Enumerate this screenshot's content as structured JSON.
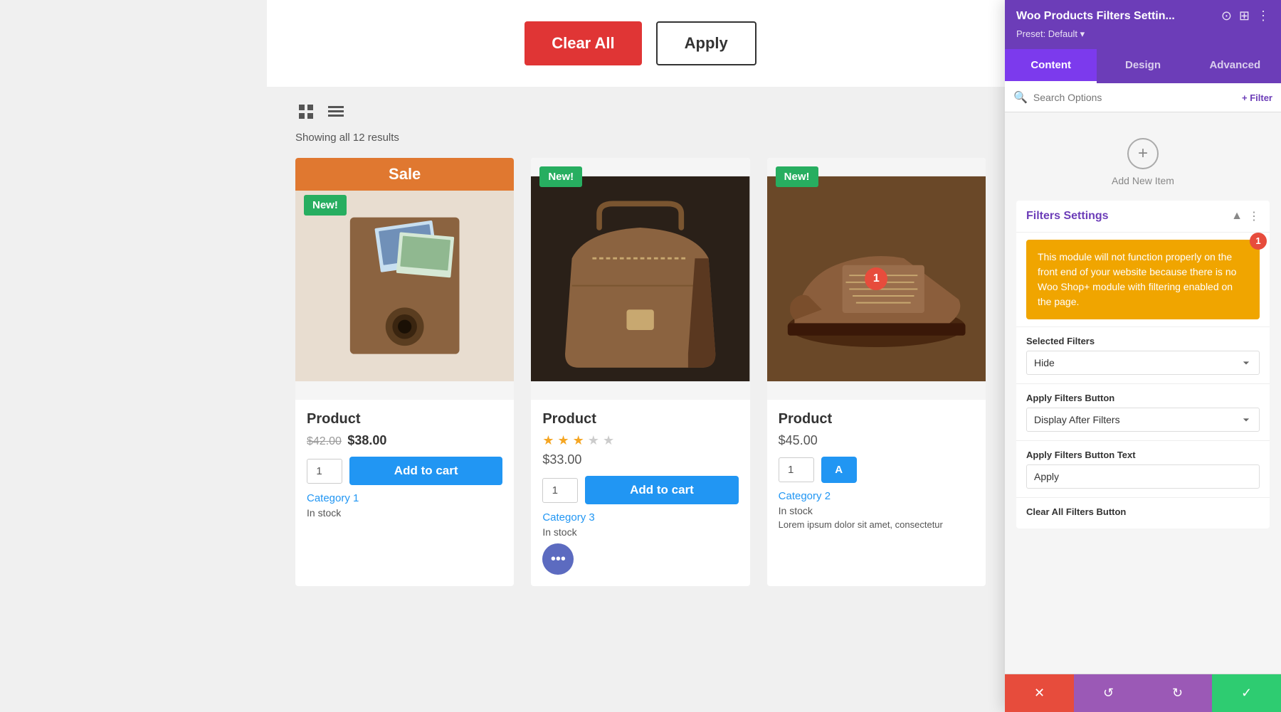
{
  "panel": {
    "title": "Woo Products Filters Settin...",
    "preset_label": "Preset: Default",
    "tabs": [
      {
        "id": "content",
        "label": "Content",
        "active": true
      },
      {
        "id": "design",
        "label": "Design",
        "active": false
      },
      {
        "id": "advanced",
        "label": "Advanced",
        "active": false
      }
    ],
    "search_placeholder": "Search Options",
    "filter_btn_label": "+ Filter",
    "add_new_item_label": "Add New Item",
    "filters_settings": {
      "title": "Filters Settings",
      "warning_text": "This module will not function properly on the front end of your website because there is no Woo Shop+ module with filtering enabled on the page.",
      "warning_badge": "1",
      "selected_filters_label": "Selected Filters",
      "selected_filters_value": "Hide",
      "apply_filters_button_label": "Apply Filters Button",
      "apply_filters_button_value": "Display After Filters",
      "apply_filters_button_text_label": "Apply Filters Button Text",
      "apply_filters_button_text_value": "Apply",
      "clear_all_filters_button_label": "Clear All Filters Button"
    },
    "toolbar": {
      "delete_icon": "✕",
      "undo_icon": "↺",
      "redo_icon": "↻",
      "save_icon": "✓"
    }
  },
  "filter_bar": {
    "clear_all_label": "Clear All",
    "apply_label": "Apply"
  },
  "products_list": {
    "showing_text": "Showing all 12 results",
    "products": [
      {
        "id": 1,
        "name": "Product",
        "badge_sale": "Sale",
        "badge_new": "New!",
        "price_old": "$42.00",
        "price_new": "$38.00",
        "qty": "1",
        "add_to_cart": "Add to cart",
        "category": "Category 1",
        "stock": "In stock",
        "has_sale": true,
        "has_new": true
      },
      {
        "id": 2,
        "name": "Product",
        "badge_new": "New!",
        "price": "$33.00",
        "stars": 3.5,
        "qty": "1",
        "add_to_cart": "Add to cart",
        "category": "Category 3",
        "stock": "In stock",
        "has_sale": false,
        "has_new": true
      },
      {
        "id": 3,
        "name": "Product",
        "badge_new": "New!",
        "price": "$45.00",
        "qty": "1",
        "add_to_cart": "A",
        "category": "Category 2",
        "stock": "In stock",
        "desc": "Lorem ipsum dolor sit amet, consectetur",
        "has_sale": false,
        "has_new": true
      }
    ]
  }
}
